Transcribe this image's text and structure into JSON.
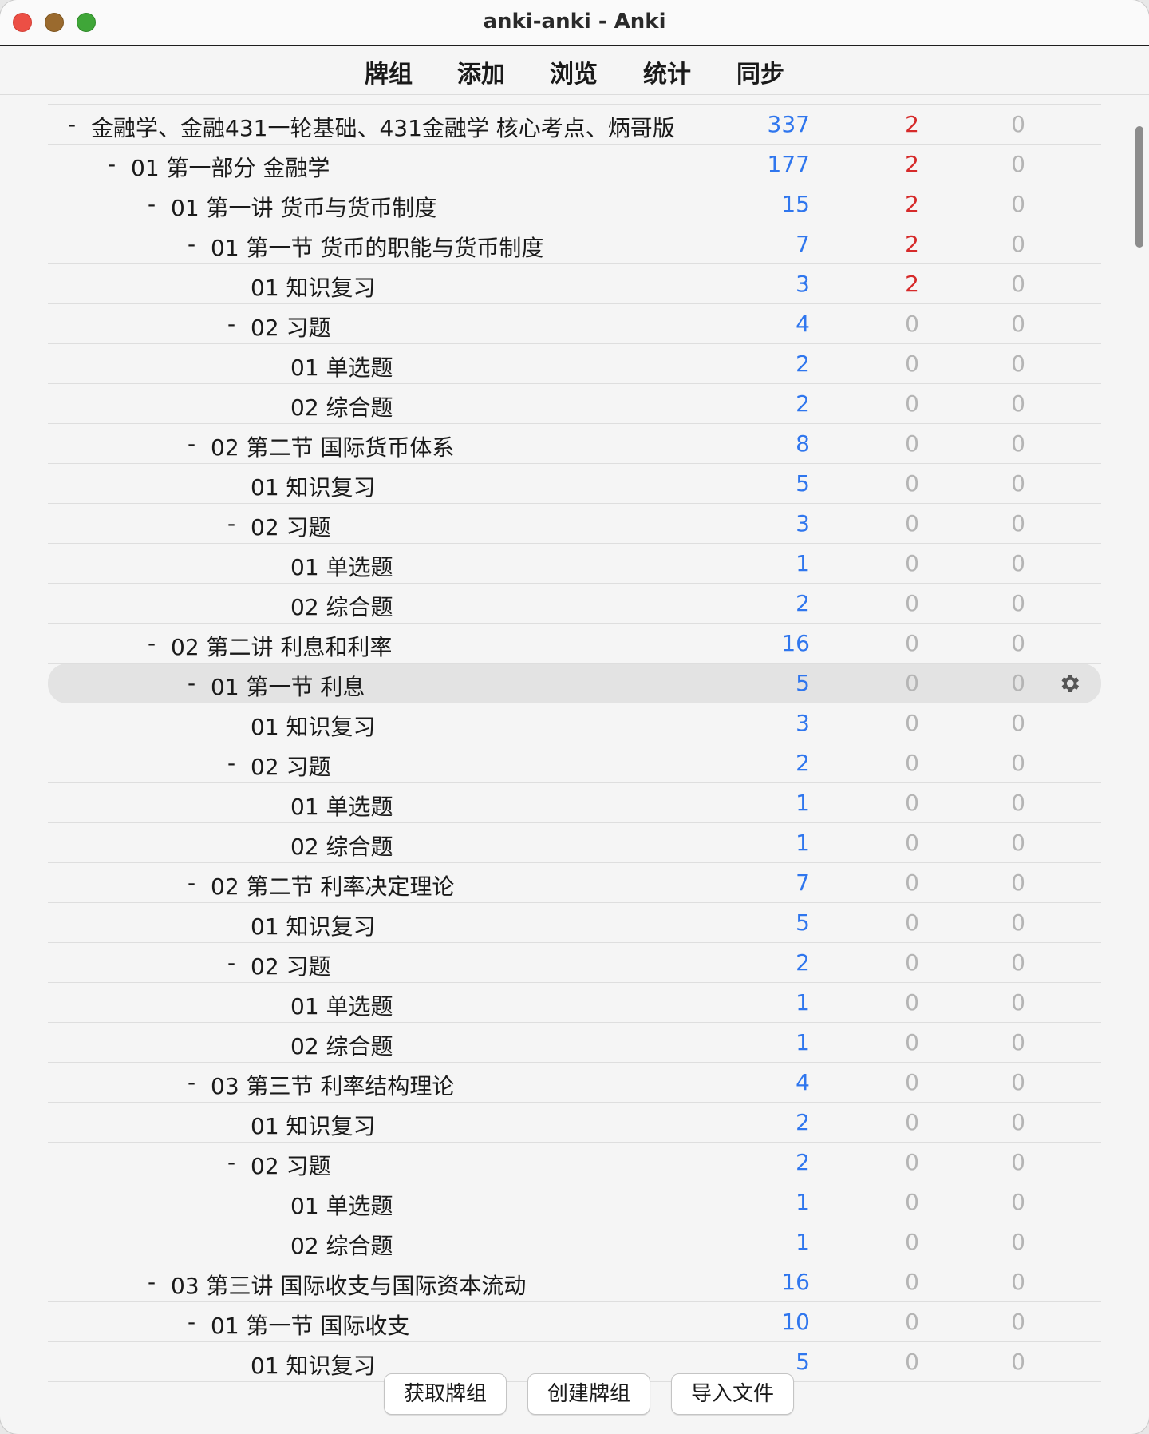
{
  "window": {
    "title": "anki-anki - Anki"
  },
  "toolbar": {
    "decks": "牌组",
    "add": "添加",
    "browse": "浏览",
    "stats": "统计",
    "sync": "同步"
  },
  "colors": {
    "new": "#2f76ee",
    "learn_active": "#d62a2a",
    "zero": "#b5b5b5"
  },
  "decks": [
    {
      "level": 0,
      "collapse": "-",
      "name": "金融学、金融431一轮基础、431金融学 核心考点、炳哥版",
      "new": "337",
      "learn": "2",
      "review": "0"
    },
    {
      "level": 1,
      "collapse": "-",
      "name": "01 第一部分 金融学",
      "new": "177",
      "learn": "2",
      "review": "0"
    },
    {
      "level": 2,
      "collapse": "-",
      "name": "01 第一讲 货币与货币制度",
      "new": "15",
      "learn": "2",
      "review": "0"
    },
    {
      "level": 3,
      "collapse": "-",
      "name": "01 第一节 货币的职能与货币制度",
      "new": "7",
      "learn": "2",
      "review": "0"
    },
    {
      "level": 4,
      "collapse": "",
      "name": "01 知识复习",
      "new": "3",
      "learn": "2",
      "review": "0"
    },
    {
      "level": 4,
      "collapse": "-",
      "name": "02 习题",
      "new": "4",
      "learn": "0",
      "review": "0"
    },
    {
      "level": 5,
      "collapse": "",
      "name": "01 单选题",
      "new": "2",
      "learn": "0",
      "review": "0"
    },
    {
      "level": 5,
      "collapse": "",
      "name": "02 综合题",
      "new": "2",
      "learn": "0",
      "review": "0"
    },
    {
      "level": 3,
      "collapse": "-",
      "name": "02 第二节 国际货币体系",
      "new": "8",
      "learn": "0",
      "review": "0"
    },
    {
      "level": 4,
      "collapse": "",
      "name": "01 知识复习",
      "new": "5",
      "learn": "0",
      "review": "0"
    },
    {
      "level": 4,
      "collapse": "-",
      "name": "02 习题",
      "new": "3",
      "learn": "0",
      "review": "0"
    },
    {
      "level": 5,
      "collapse": "",
      "name": "01 单选题",
      "new": "1",
      "learn": "0",
      "review": "0"
    },
    {
      "level": 5,
      "collapse": "",
      "name": "02 综合题",
      "new": "2",
      "learn": "0",
      "review": "0"
    },
    {
      "level": 2,
      "collapse": "-",
      "name": "02 第二讲 利息和利率",
      "new": "16",
      "learn": "0",
      "review": "0"
    },
    {
      "level": 3,
      "collapse": "-",
      "name": "01 第一节 利息",
      "new": "5",
      "learn": "0",
      "review": "0",
      "selected": true
    },
    {
      "level": 4,
      "collapse": "",
      "name": "01 知识复习",
      "new": "3",
      "learn": "0",
      "review": "0"
    },
    {
      "level": 4,
      "collapse": "-",
      "name": "02 习题",
      "new": "2",
      "learn": "0",
      "review": "0"
    },
    {
      "level": 5,
      "collapse": "",
      "name": "01 单选题",
      "new": "1",
      "learn": "0",
      "review": "0"
    },
    {
      "level": 5,
      "collapse": "",
      "name": "02 综合题",
      "new": "1",
      "learn": "0",
      "review": "0"
    },
    {
      "level": 3,
      "collapse": "-",
      "name": "02 第二节 利率决定理论",
      "new": "7",
      "learn": "0",
      "review": "0"
    },
    {
      "level": 4,
      "collapse": "",
      "name": "01 知识复习",
      "new": "5",
      "learn": "0",
      "review": "0"
    },
    {
      "level": 4,
      "collapse": "-",
      "name": "02 习题",
      "new": "2",
      "learn": "0",
      "review": "0"
    },
    {
      "level": 5,
      "collapse": "",
      "name": "01 单选题",
      "new": "1",
      "learn": "0",
      "review": "0"
    },
    {
      "level": 5,
      "collapse": "",
      "name": "02 综合题",
      "new": "1",
      "learn": "0",
      "review": "0"
    },
    {
      "level": 3,
      "collapse": "-",
      "name": "03 第三节 利率结构理论",
      "new": "4",
      "learn": "0",
      "review": "0"
    },
    {
      "level": 4,
      "collapse": "",
      "name": "01 知识复习",
      "new": "2",
      "learn": "0",
      "review": "0"
    },
    {
      "level": 4,
      "collapse": "-",
      "name": "02 习题",
      "new": "2",
      "learn": "0",
      "review": "0"
    },
    {
      "level": 5,
      "collapse": "",
      "name": "01 单选题",
      "new": "1",
      "learn": "0",
      "review": "0"
    },
    {
      "level": 5,
      "collapse": "",
      "name": "02 综合题",
      "new": "1",
      "learn": "0",
      "review": "0"
    },
    {
      "level": 2,
      "collapse": "-",
      "name": "03 第三讲 国际收支与国际资本流动",
      "new": "16",
      "learn": "0",
      "review": "0"
    },
    {
      "level": 3,
      "collapse": "-",
      "name": "01 第一节 国际收支",
      "new": "10",
      "learn": "0",
      "review": "0"
    },
    {
      "level": 4,
      "collapse": "",
      "name": "01 知识复习",
      "new": "5",
      "learn": "0",
      "review": "0"
    }
  ],
  "bottom": {
    "get_shared": "获取牌组",
    "create_deck": "创建牌组",
    "import_file": "导入文件"
  }
}
